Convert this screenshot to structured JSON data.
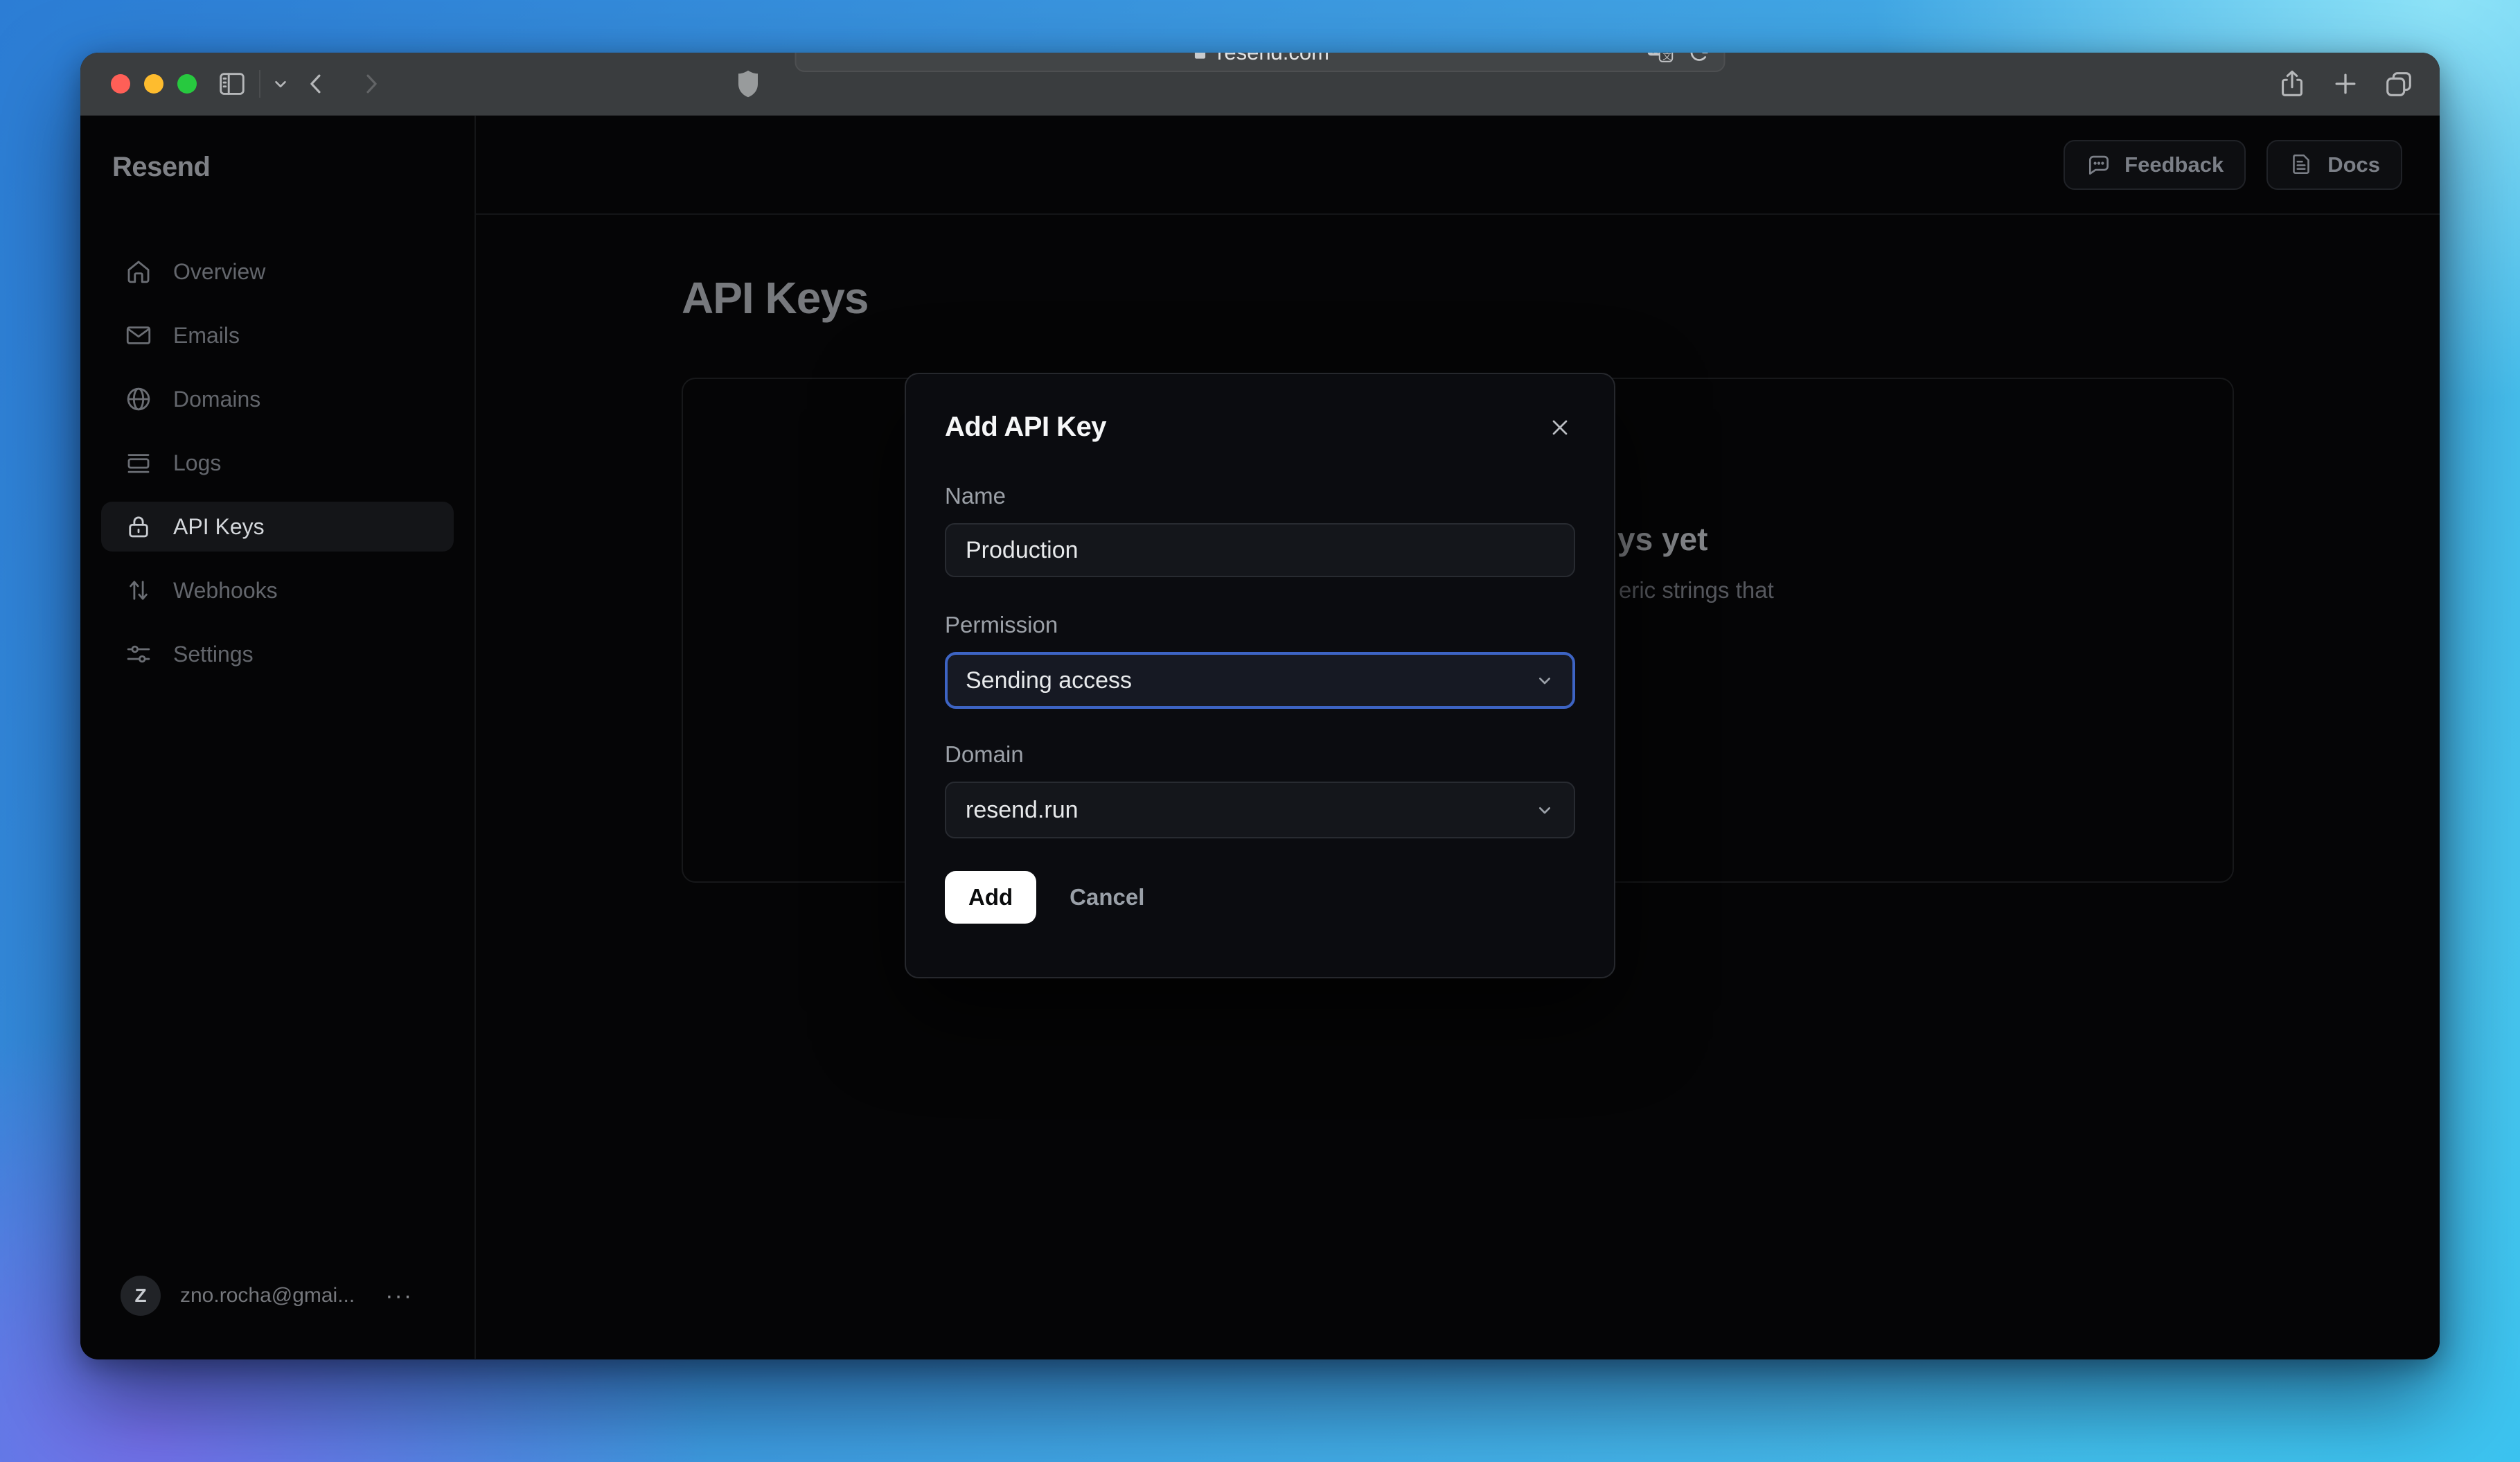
{
  "browser": {
    "url": "resend.com",
    "window_controls": [
      "close",
      "minimize",
      "zoom"
    ]
  },
  "sidebar": {
    "logo": "Resend",
    "items": [
      {
        "label": "Overview",
        "icon": "home-icon",
        "active": false
      },
      {
        "label": "Emails",
        "icon": "mail-icon",
        "active": false
      },
      {
        "label": "Domains",
        "icon": "globe-icon",
        "active": false
      },
      {
        "label": "Logs",
        "icon": "logs-icon",
        "active": false
      },
      {
        "label": "API Keys",
        "icon": "lock-icon",
        "active": true
      },
      {
        "label": "Webhooks",
        "icon": "arrows-up-down-icon",
        "active": false
      },
      {
        "label": "Settings",
        "icon": "sliders-icon",
        "active": false
      }
    ],
    "account": {
      "avatar_initial": "Z",
      "email": "zno.rocha@gmai...",
      "menu_glyph": "···"
    }
  },
  "header": {
    "feedback_label": "Feedback",
    "docs_label": "Docs"
  },
  "page": {
    "title": "API Keys",
    "heading_fragment": "ys yet",
    "body_fragment": "eric strings that"
  },
  "modal": {
    "title": "Add API Key",
    "name_label": "Name",
    "name_value": "Production",
    "permission_label": "Permission",
    "permission_value": "Sending access",
    "domain_label": "Domain",
    "domain_value": "resend.run",
    "add_label": "Add",
    "cancel_label": "Cancel"
  },
  "colors": {
    "focus_ring": "#3d64c4",
    "traffic_red": "#ff5f57",
    "traffic_yellow": "#febc2e",
    "traffic_green": "#27c93f",
    "gradient_top_left": "#2c7dd5",
    "gradient_top_right": "#8ee3f8",
    "gradient_bottom_left": "#7671ec",
    "gradient_bottom_right": "#3cc3f0",
    "app_background": "#050506",
    "modal_background": "#0b0c10"
  }
}
